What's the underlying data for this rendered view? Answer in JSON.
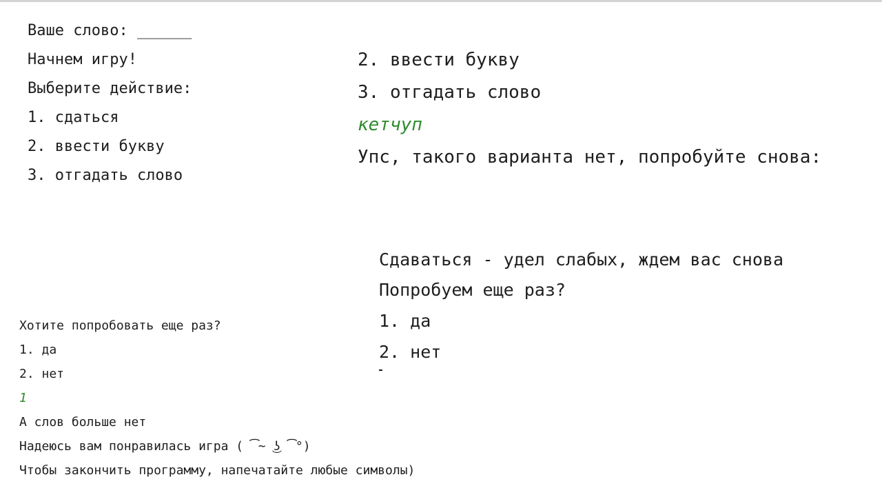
{
  "panel1": {
    "lines": [
      "Ваше слово: ______",
      "Начнем игру!",
      "Выберите действие:",
      "1. сдаться",
      "2. ввести букву",
      "3. отгадать слово"
    ]
  },
  "panel2": {
    "lines": [
      "2. ввести букву",
      "3. отгадать слово"
    ],
    "user_input": "кетчуп",
    "error": "Упс, такого варианта нет, попробуйте снова:"
  },
  "panel3": {
    "lines": [
      "Сдаваться - удел слабых, ждем вас снова",
      "Попробуем еще раз?",
      "1. да",
      "2. нет"
    ]
  },
  "panel4": {
    "lines_before": [
      "Хотите попробовать еще раз?",
      "1. да",
      "2. нет"
    ],
    "user_input": "1",
    "lines_after": [
      "А слов больше нет",
      "Надеюсь вам понравилась игра ( ͡~ ͜ʖ ͡°)",
      "Чтобы закончить программу, напечатайте любые символы)"
    ]
  },
  "colors": {
    "text": "#1e1e1e",
    "user_input": "#2e8b2e",
    "background": "#ffffff"
  }
}
